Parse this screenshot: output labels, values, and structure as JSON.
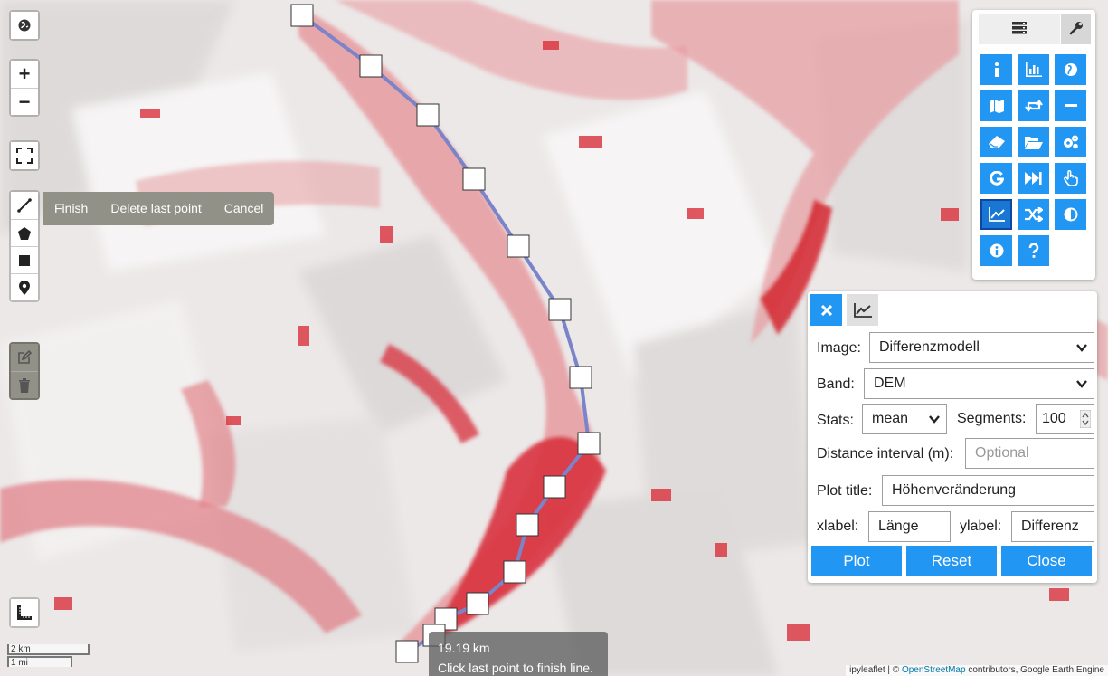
{
  "map": {
    "draw_actions": {
      "finish": "Finish",
      "delete_last": "Delete last point",
      "cancel": "Cancel"
    },
    "zoom_in": "+",
    "zoom_out": "−",
    "tooltip": {
      "distance": "19.19 km",
      "hint": "Click last point to finish line."
    },
    "scale": {
      "metric": "2 km",
      "imperial": "1 mi"
    },
    "attribution": {
      "prefix": "ipyleaflet | © ",
      "osm": "OpenStreetMap",
      "suffix": " contributors, Google Earth Engine"
    },
    "colors": {
      "line": "#7b84c9",
      "glacier": "#dc3c46"
    }
  },
  "toolbar": {
    "tabs": [
      "layers-icon",
      "wrench-icon"
    ],
    "tools": [
      "info-icon",
      "bar-chart-icon",
      "globe-icon",
      "map-icon",
      "retweet-icon",
      "minus-icon",
      "eraser-icon",
      "folder-open-icon",
      "gears-icon",
      "google-icon",
      "fast-forward-icon",
      "hand-pointer-icon",
      "line-chart-icon",
      "random-icon",
      "adjust-icon",
      "info-circle-icon",
      "question-icon"
    ],
    "selected": "line-chart-icon",
    "accent": "#2196f3"
  },
  "plot_panel": {
    "image_label": "Image:",
    "image_value": "Differenzmodell",
    "band_label": "Band:",
    "band_value": "DEM",
    "stats_label": "Stats:",
    "stats_value": "mean",
    "segments_label": "Segments:",
    "segments_value": "100",
    "distance_label": "Distance interval (m):",
    "distance_placeholder": "Optional",
    "title_label": "Plot title:",
    "title_value": "Höhenveränderung",
    "xlabel_label": "xlabel:",
    "xlabel_value": "Länge",
    "ylabel_label": "ylabel:",
    "ylabel_value": "Differenz",
    "plot_button": "Plot",
    "reset_button": "Reset",
    "close_button": "Close"
  }
}
